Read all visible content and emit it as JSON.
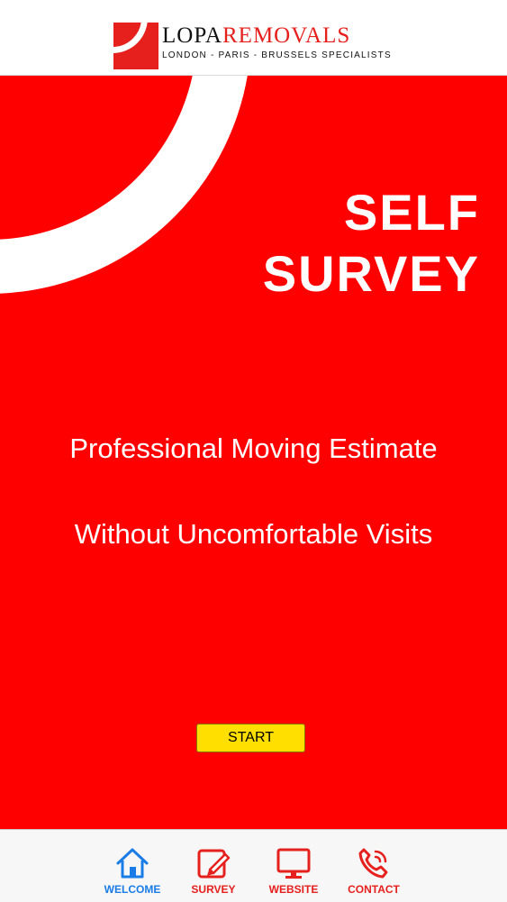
{
  "header": {
    "brand_part1": "LOPA",
    "brand_part2": "REMOVALS",
    "subtitle": "LONDON - PARIS - BRUSSELS  SPECIALISTS"
  },
  "hero": {
    "title_line1": "SELF",
    "title_line2": "SURVEY",
    "tagline1": "Professional Moving Estimate",
    "tagline2": "Without Uncomfortable Visits",
    "start_label": "START"
  },
  "tabbar": {
    "tabs": [
      {
        "label": "WELCOME",
        "icon": "home-icon",
        "color": "#1a7ce6"
      },
      {
        "label": "SURVEY",
        "icon": "edit-icon",
        "color": "#e5201d"
      },
      {
        "label": "WEBSITE",
        "icon": "monitor-icon",
        "color": "#e5201d"
      },
      {
        "label": "CONTACT",
        "icon": "phone-icon",
        "color": "#e5201d"
      }
    ]
  },
  "colors": {
    "brand_red": "#ff0000",
    "button_yellow": "#ffdf00",
    "active_tab_blue": "#1a7ce6"
  }
}
